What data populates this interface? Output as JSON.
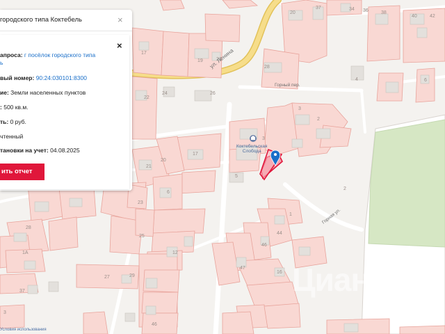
{
  "map": {
    "street_lenina": "ул. Ленина",
    "street_gorny_per": "Горный пер.",
    "street_gornaya": "Горная ул.",
    "poi_name_line1": "Коктебельская",
    "poi_name_line2": "Слобода",
    "watermark": "Циан",
    "terms_link": "Условия использования",
    "house_numbers": [
      {
        "label": "20"
      },
      {
        "label": "37"
      },
      {
        "label": "34"
      },
      {
        "label": "36"
      },
      {
        "label": "38"
      },
      {
        "label": "40"
      },
      {
        "label": "42"
      },
      {
        "label": "17"
      },
      {
        "label": "19"
      },
      {
        "label": "21"
      },
      {
        "label": "28"
      },
      {
        "label": "4"
      },
      {
        "label": "6"
      },
      {
        "label": "22"
      },
      {
        "label": "24"
      },
      {
        "label": "26"
      },
      {
        "label": "3"
      },
      {
        "label": "2"
      },
      {
        "label": "3"
      },
      {
        "label": "5"
      },
      {
        "label": "17"
      },
      {
        "label": "21"
      },
      {
        "label": "20"
      },
      {
        "label": "6"
      },
      {
        "label": "23"
      },
      {
        "label": "25"
      },
      {
        "label": "12"
      },
      {
        "label": "2"
      },
      {
        "label": "1"
      },
      {
        "label": "44"
      },
      {
        "label": "46"
      },
      {
        "label": "47"
      },
      {
        "label": "16"
      },
      {
        "label": "28"
      },
      {
        "label": "1А"
      },
      {
        "label": "37"
      },
      {
        "label": "27"
      },
      {
        "label": "29"
      },
      {
        "label": "3"
      },
      {
        "label": "46"
      }
    ]
  },
  "card": {
    "title": "городского типа Коктебель",
    "close_icon": "×",
    "inner_close_icon": "×",
    "rows": {
      "request_label": "апроса:",
      "request_value_line1": "г посёлок городского типа",
      "request_value_line2": "ь",
      "cadastral_label": "вый номер:",
      "cadastral_value": "90:24:030101:8300",
      "category_label": "ие:",
      "category_value": "Земли населенных пунктов",
      "area_label": ":",
      "area_value": "500 кв.м.",
      "cost_label": "ть:",
      "cost_value": "0 руб.",
      "status_value": "чтенный",
      "reg_date_label": "тановки на учет:",
      "reg_date_value": "04.08.2025"
    },
    "report_button": "ить отчет"
  },
  "colors": {
    "parcel_fill": "#f9d8d3",
    "parcel_stroke": "#e8a39b",
    "selected_parcel": "#e0173b",
    "road_main": "#f6dd8a",
    "marker": "#1a6fc9",
    "button": "#e0173b"
  }
}
